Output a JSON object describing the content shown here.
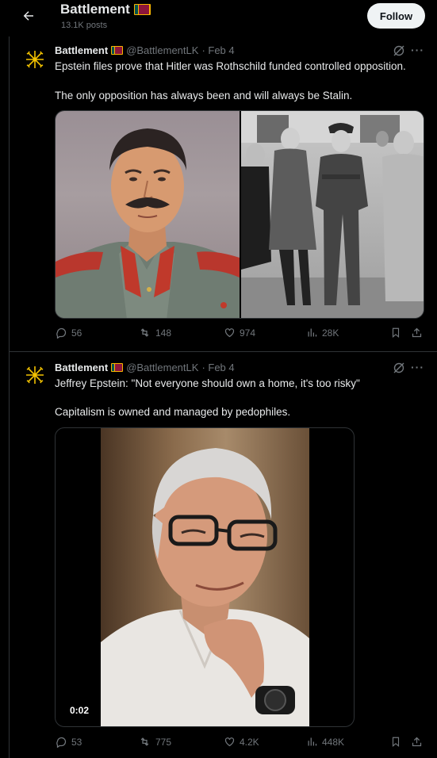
{
  "header": {
    "title": "Battlement",
    "posts_count": "13.1K posts",
    "follow_label": "Follow"
  },
  "posts": [
    {
      "name": "Battlement",
      "handle": "@BattlementLK",
      "date": "· Feb 4",
      "text_line1": "Epstein files prove that Hitler was Rothschild funded controlled opposition.",
      "text_line2": "The only opposition has always been and will always be Stalin.",
      "replies": "56",
      "reposts": "148",
      "likes": "974",
      "views": "28K",
      "images": [
        "portrait-painting",
        "black-and-white-group-photo"
      ]
    },
    {
      "name": "Battlement",
      "handle": "@BattlementLK",
      "date": "· Feb 4",
      "text_line1": "Jeffrey Epstein: \"Not everyone should own a home, it's too risky\"",
      "text_line2": "Capitalism is owned and managed by pedophiles.",
      "video_time": "0:02",
      "replies": "53",
      "reposts": "775",
      "likes": "4.2K",
      "views": "448K"
    }
  ],
  "icons": {
    "back": "arrow-left-icon",
    "reply": "speech-bubble-icon",
    "repost": "repost-arrows-icon",
    "like": "heart-icon",
    "views": "bar-chart-icon",
    "bookmark": "bookmark-icon",
    "share": "share-upload-icon",
    "grok": "grok-icon",
    "more": "ellipsis-icon"
  },
  "colors": {
    "background": "#000000",
    "text": "#e7e9ea",
    "muted": "#71767b",
    "border": "#2f3336",
    "avatar": "#f2c200"
  }
}
